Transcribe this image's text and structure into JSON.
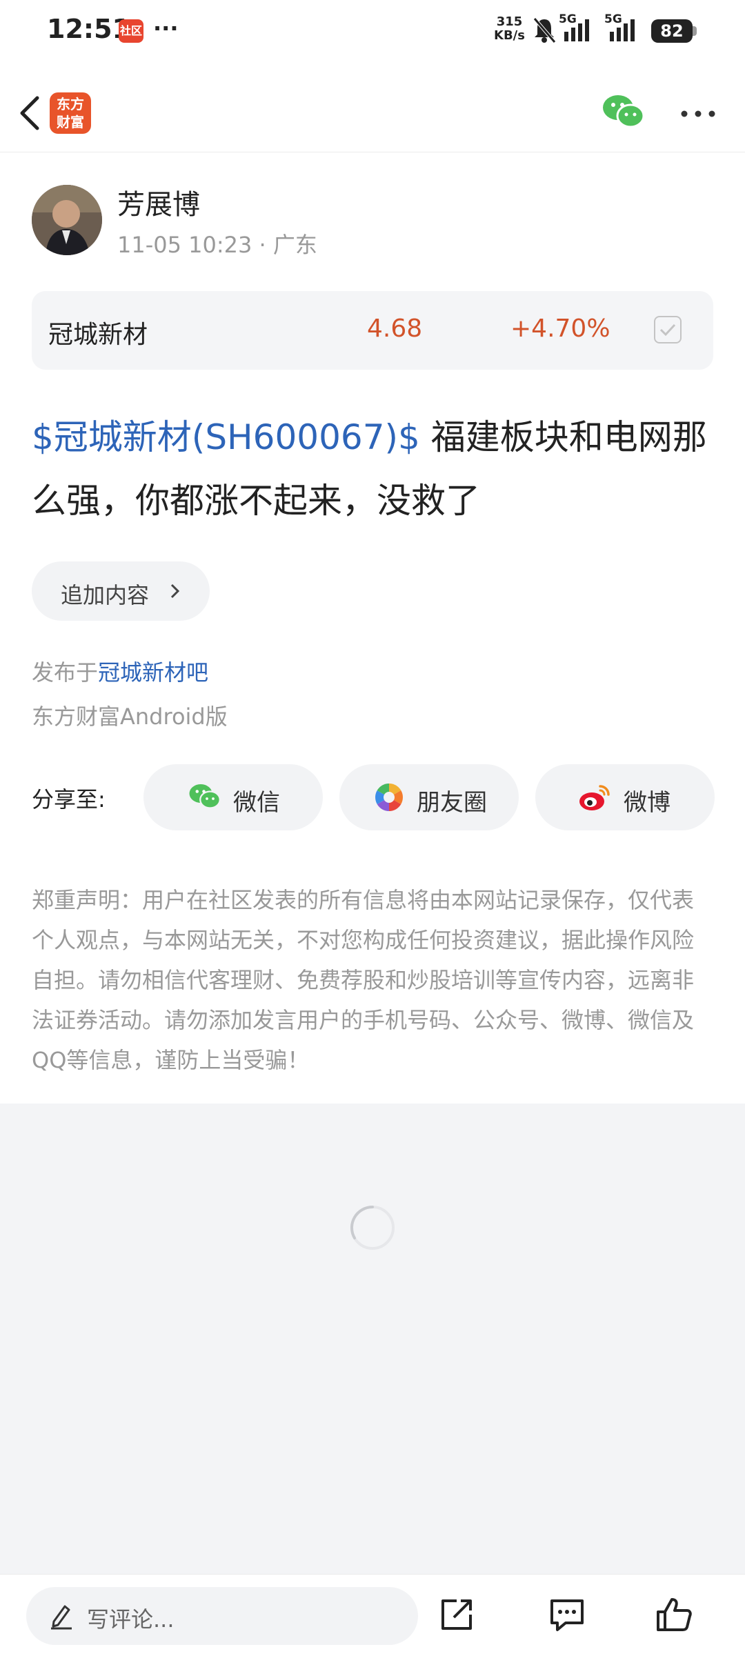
{
  "status_bar": {
    "time": "12:51",
    "app_badge": "社区",
    "more": "···",
    "speed_value": "315",
    "speed_unit": "KB/s",
    "net1": "5G",
    "net2": "5G",
    "battery": "82"
  },
  "nav": {
    "logo_line1": "东方",
    "logo_line2": "财富"
  },
  "post": {
    "author": "芳展博",
    "timestamp": "11-05 10:23",
    "separator": " · ",
    "location": "广东",
    "stock_card": {
      "name": "冠城新材",
      "price": "4.68",
      "change": "+4.70%"
    },
    "stock_link": "$冠城新材(SH600067)$",
    "body_text": " 福建板块和电网那么强，你都涨不起来，没救了",
    "append_label": "追加内容",
    "posted_in_prefix": "发布于",
    "forum_name": "冠城新材吧",
    "client_version": "东方财富Android版"
  },
  "share": {
    "label": "分享至:",
    "wechat": "微信",
    "moments": "朋友圈",
    "weibo": "微博"
  },
  "disclaimer": "郑重声明：用户在社区发表的所有信息将由本网站记录保存，仅代表个人观点，与本网站无关，不对您构成任何投资建议，据此操作风险自担。请勿相信代客理财、免费荐股和炒股培训等宣传内容，远离非法证券活动。请勿添加发言用户的手机号码、公众号、微博、微信及QQ等信息，谨防上当受骗！",
  "bottom_bar": {
    "comment_placeholder": "写评论..."
  },
  "colors": {
    "link_blue": "#2d64b8",
    "price_red": "#d2532a",
    "brand_orange": "#e8542a"
  }
}
